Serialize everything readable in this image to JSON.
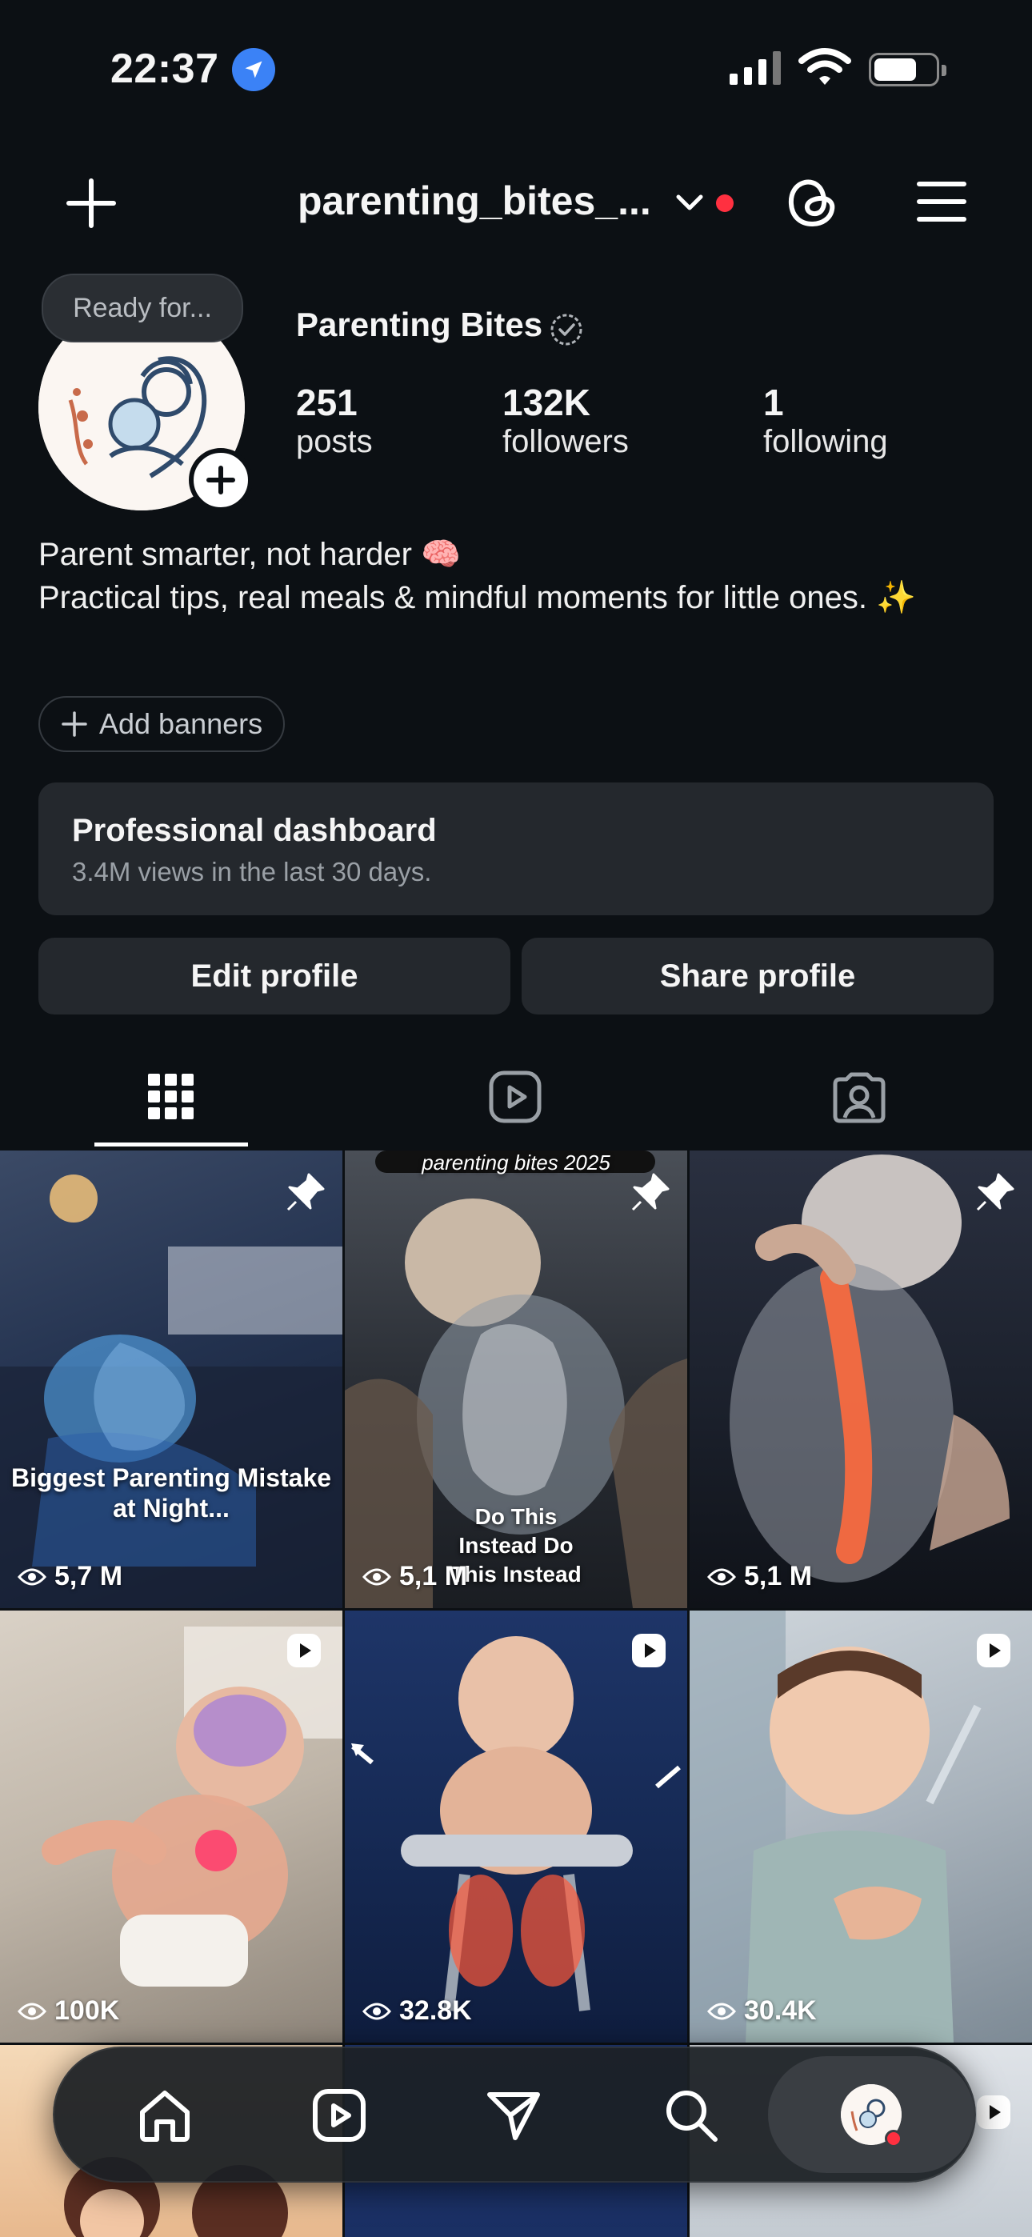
{
  "status_bar": {
    "time": "22:37"
  },
  "header": {
    "username": "parenting_bites_..."
  },
  "profile": {
    "note": "Ready for...",
    "display_name": "Parenting Bites",
    "stats": [
      {
        "value": "251",
        "label": "posts"
      },
      {
        "value": "132K",
        "label": "followers"
      },
      {
        "value": "1",
        "label": "following"
      }
    ],
    "bio_line1": "Parent smarter, not harder 🧠",
    "bio_line2": "Practical tips, real meals & mindful moments for little ones. ✨",
    "add_banners": "Add banners"
  },
  "dashboard": {
    "title": "Professional dashboard",
    "subtitle": "3.4M views in the last 30 days."
  },
  "actions": {
    "edit": "Edit profile",
    "share": "Share profile"
  },
  "grid": [
    {
      "views": "5,7 M",
      "badge": "pin-icon",
      "caption": "Biggest Parenting Mistake at Night..."
    },
    {
      "views": "5,1 M",
      "badge": "pin-icon",
      "caption": "Do This Instead Do This Instead",
      "top_caption": "parenting bites 2025"
    },
    {
      "views": "5,1 M",
      "badge": "pin-icon",
      "caption": ""
    },
    {
      "views": "100K",
      "badge": "reel-icon",
      "caption": ""
    },
    {
      "views": "32.8K",
      "badge": "reel-icon",
      "caption": ""
    },
    {
      "views": "30.4K",
      "badge": "reel-icon",
      "caption": ""
    }
  ],
  "colors": {
    "background": "#0c1014",
    "card": "#24282d",
    "notification": "#ff3040",
    "location": "#3b82f6"
  }
}
